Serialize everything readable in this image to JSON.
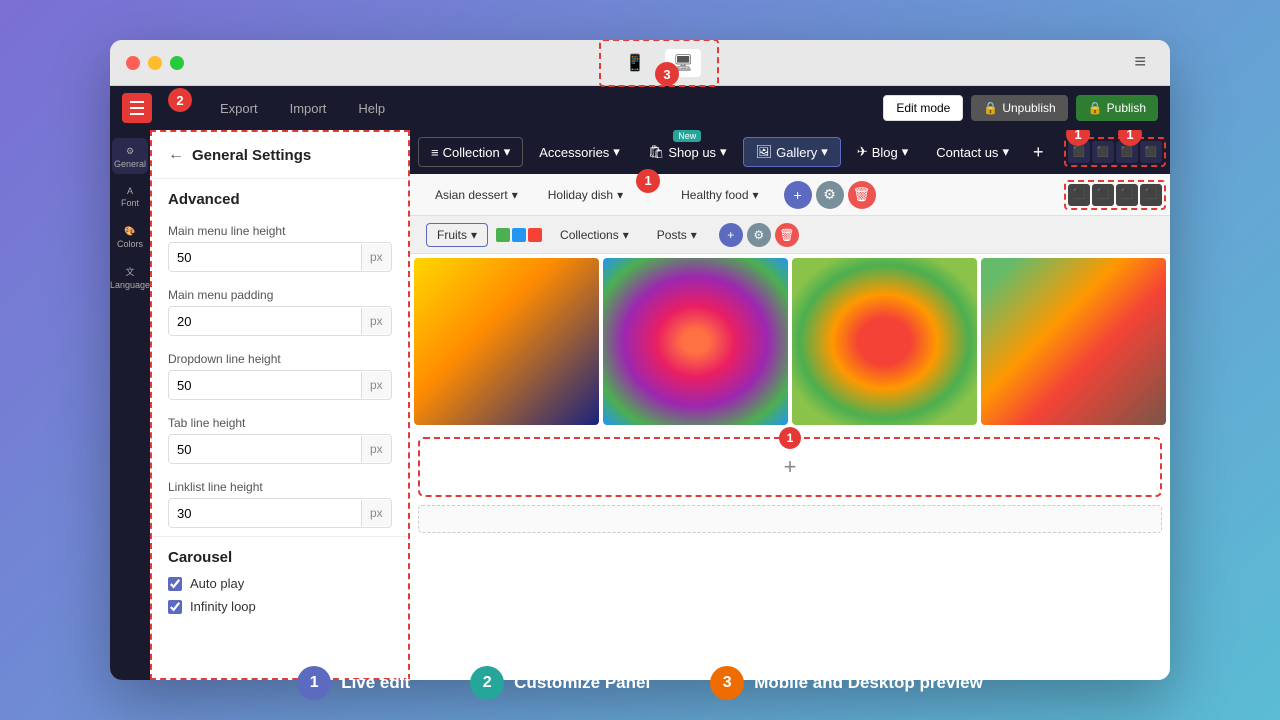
{
  "browser": {
    "dots": [
      "red",
      "yellow",
      "green"
    ],
    "device_preview_label": "Device Preview",
    "hamburger": "≡"
  },
  "toolbar": {
    "menu_icon_lines": 3,
    "export_label": "Export",
    "import_label": "Import",
    "help_label": "Help",
    "edit_mode_label": "Edit mode",
    "unpublish_label": "Unpublish",
    "publish_label": "Publish"
  },
  "sidebar": {
    "items": [
      {
        "label": "General",
        "icon": "⚙"
      },
      {
        "label": "Font",
        "icon": "A"
      },
      {
        "label": "Colors",
        "icon": "🎨"
      },
      {
        "label": "Language",
        "icon": "🌐"
      }
    ]
  },
  "settings_panel": {
    "title": "General Settings",
    "section_advanced": "Advanced",
    "fields": [
      {
        "label": "Main menu line height",
        "value": "50",
        "unit": "px"
      },
      {
        "label": "Main menu padding",
        "value": "20",
        "unit": "px"
      },
      {
        "label": "Dropdown line height",
        "value": "50",
        "unit": "px"
      },
      {
        "label": "Tab line height",
        "value": "50",
        "unit": "px"
      },
      {
        "label": "Linklist line height",
        "value": "30",
        "unit": "px"
      }
    ],
    "carousel_title": "Carousel",
    "carousel_items": [
      {
        "label": "Auto play",
        "checked": true
      },
      {
        "label": "Infinity loop",
        "checked": true
      }
    ]
  },
  "website": {
    "nav_items": [
      {
        "label": "Collection",
        "icon": "≡",
        "has_dropdown": true
      },
      {
        "label": "Accessories",
        "has_dropdown": true
      },
      {
        "label": "Shop us",
        "icon": "🛍",
        "has_dropdown": true,
        "badge_new": true
      },
      {
        "label": "Gallery",
        "icon": "🖼",
        "has_dropdown": true
      },
      {
        "label": "Blog",
        "icon": "✈",
        "has_dropdown": true
      },
      {
        "label": "Contact us",
        "has_dropdown": true
      }
    ],
    "subnav_items": [
      {
        "label": "Asian dessert",
        "has_dropdown": true
      },
      {
        "label": "Holiday dish",
        "has_dropdown": true
      },
      {
        "label": "Healthy food",
        "has_dropdown": true
      }
    ],
    "subnav2_items": [
      {
        "label": "Fruits",
        "has_dropdown": true
      },
      {
        "label": "Collections",
        "has_dropdown": true
      },
      {
        "label": "Posts",
        "has_dropdown": true
      }
    ],
    "add_plus": "+",
    "images": [
      {
        "alt": "Mango and blueberries"
      },
      {
        "alt": "Tropical fruits bowl"
      },
      {
        "alt": "Colorful fruit platter"
      },
      {
        "alt": "Vegetable and fruit mix"
      }
    ]
  },
  "step_labels": {
    "step1": "1",
    "step2": "2",
    "step3": "3",
    "live_edit": "Live edit",
    "customize_panel": "Customize Panel",
    "mobile_desktop": "Mobile and Desktop preview"
  }
}
